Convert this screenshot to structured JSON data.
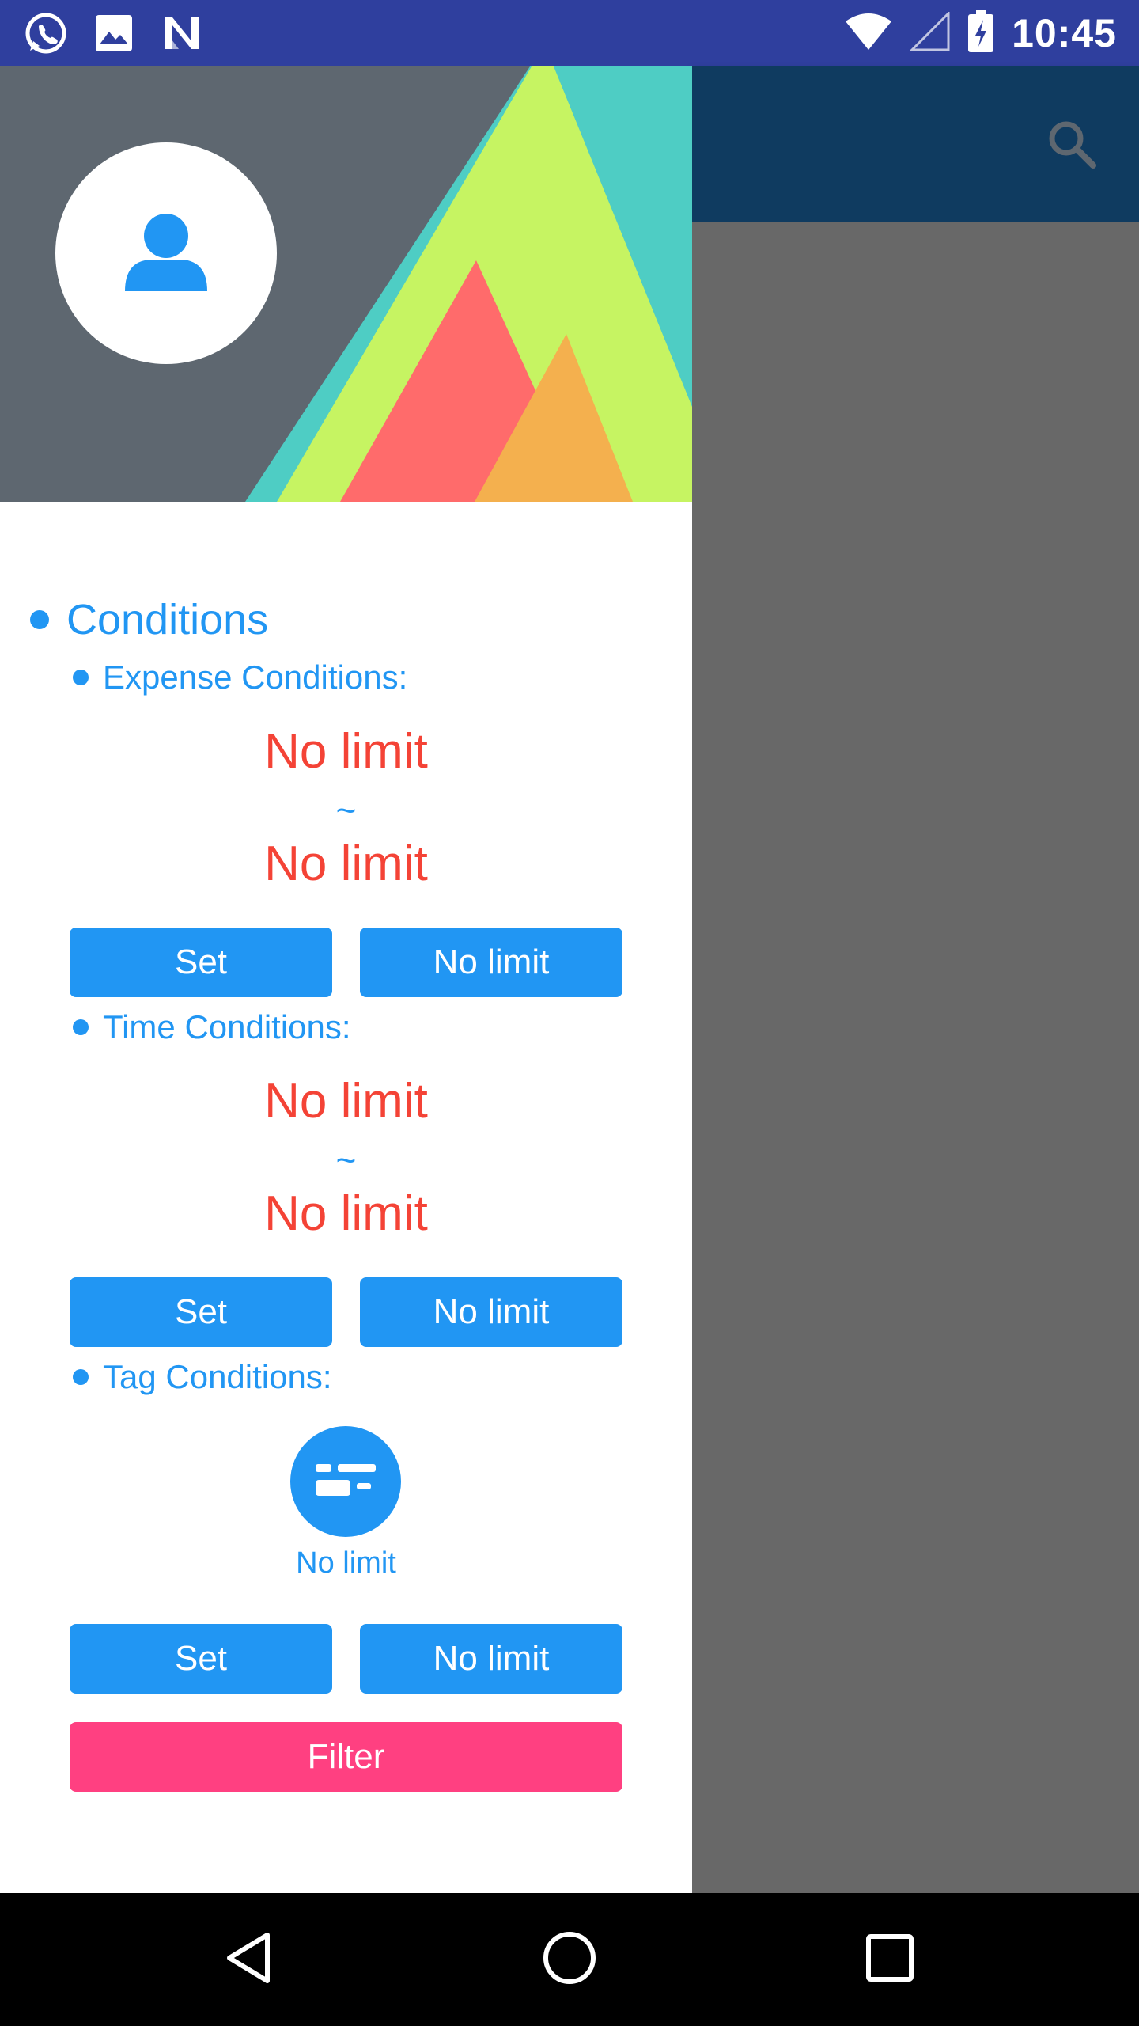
{
  "status_bar": {
    "time": "10:45",
    "left_icons": [
      "whatsapp-icon",
      "image-icon",
      "n-notification-icon"
    ],
    "right_icons": [
      "wifi-icon",
      "signal-icon",
      "battery-charging-icon"
    ]
  },
  "appbar": {
    "color": "#0f3b60",
    "actions": [
      "search-icon"
    ]
  },
  "drawer": {
    "header": {
      "background": "#5e6770",
      "avatar_icon": "user-icon"
    },
    "conditions": {
      "title": "Conditions",
      "expense": {
        "label": "Expense Conditions:",
        "min": "No limit",
        "separator": "~",
        "max": "No limit",
        "set_label": "Set",
        "nolimit_label": "No limit"
      },
      "time": {
        "label": "Time Conditions:",
        "min": "No limit",
        "separator": "~",
        "max": "No limit",
        "set_label": "Set",
        "nolimit_label": "No limit"
      },
      "tag": {
        "label": "Tag Conditions:",
        "icon": "tag-list-icon",
        "value": "No limit",
        "set_label": "Set",
        "nolimit_label": "No limit"
      }
    },
    "filter_label": "Filter"
  },
  "colors": {
    "accent": "#2196f3",
    "warning": "#f44336",
    "filter": "#ff4081",
    "status_bar": "#2f3f9e"
  },
  "navbar": {
    "buttons": [
      "back-icon",
      "home-icon",
      "recents-icon"
    ]
  }
}
